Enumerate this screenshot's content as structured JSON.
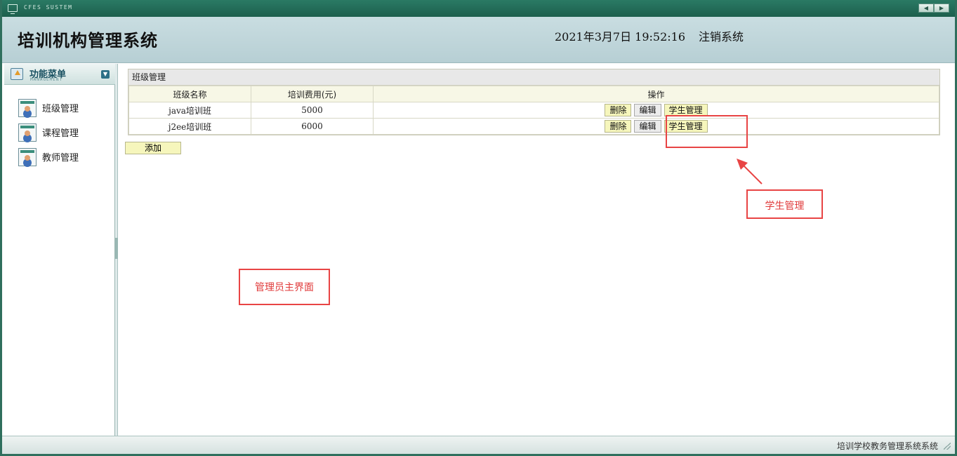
{
  "window": {
    "system_name": "CFES SUSTEM",
    "prev_label": "◀",
    "next_label": "▶"
  },
  "header": {
    "title": "培训机构管理系统",
    "datetime": "2021年3月7日 19:52:16",
    "logout_label": "注销系统"
  },
  "sidebar": {
    "menu_title": "功能菜单",
    "menu_subtitle": "MANAGEMENT",
    "items": [
      {
        "label": "班级管理"
      },
      {
        "label": "课程管理"
      },
      {
        "label": "教师管理"
      }
    ]
  },
  "main": {
    "panel_title": "班级管理",
    "columns": [
      "班级名称",
      "培训费用(元)",
      "操作"
    ],
    "rows": [
      {
        "name": "java培训班",
        "fee": "5000"
      },
      {
        "name": "j2ee培训班",
        "fee": "6000"
      }
    ],
    "actions": {
      "delete_label": "删除",
      "edit_label": "编辑",
      "students_label": "学生管理"
    },
    "add_label": "添加"
  },
  "annotations": {
    "student_mgmt": "学生管理",
    "admin_main": "管理员主界面"
  },
  "statusbar": {
    "text": "培训学校教务管理系统系统"
  },
  "colors": {
    "frame": "#2f6f5d",
    "header_bg": "#c9dde1",
    "button_yellow": "#f6f6bc",
    "annotation_red": "#e84444"
  }
}
